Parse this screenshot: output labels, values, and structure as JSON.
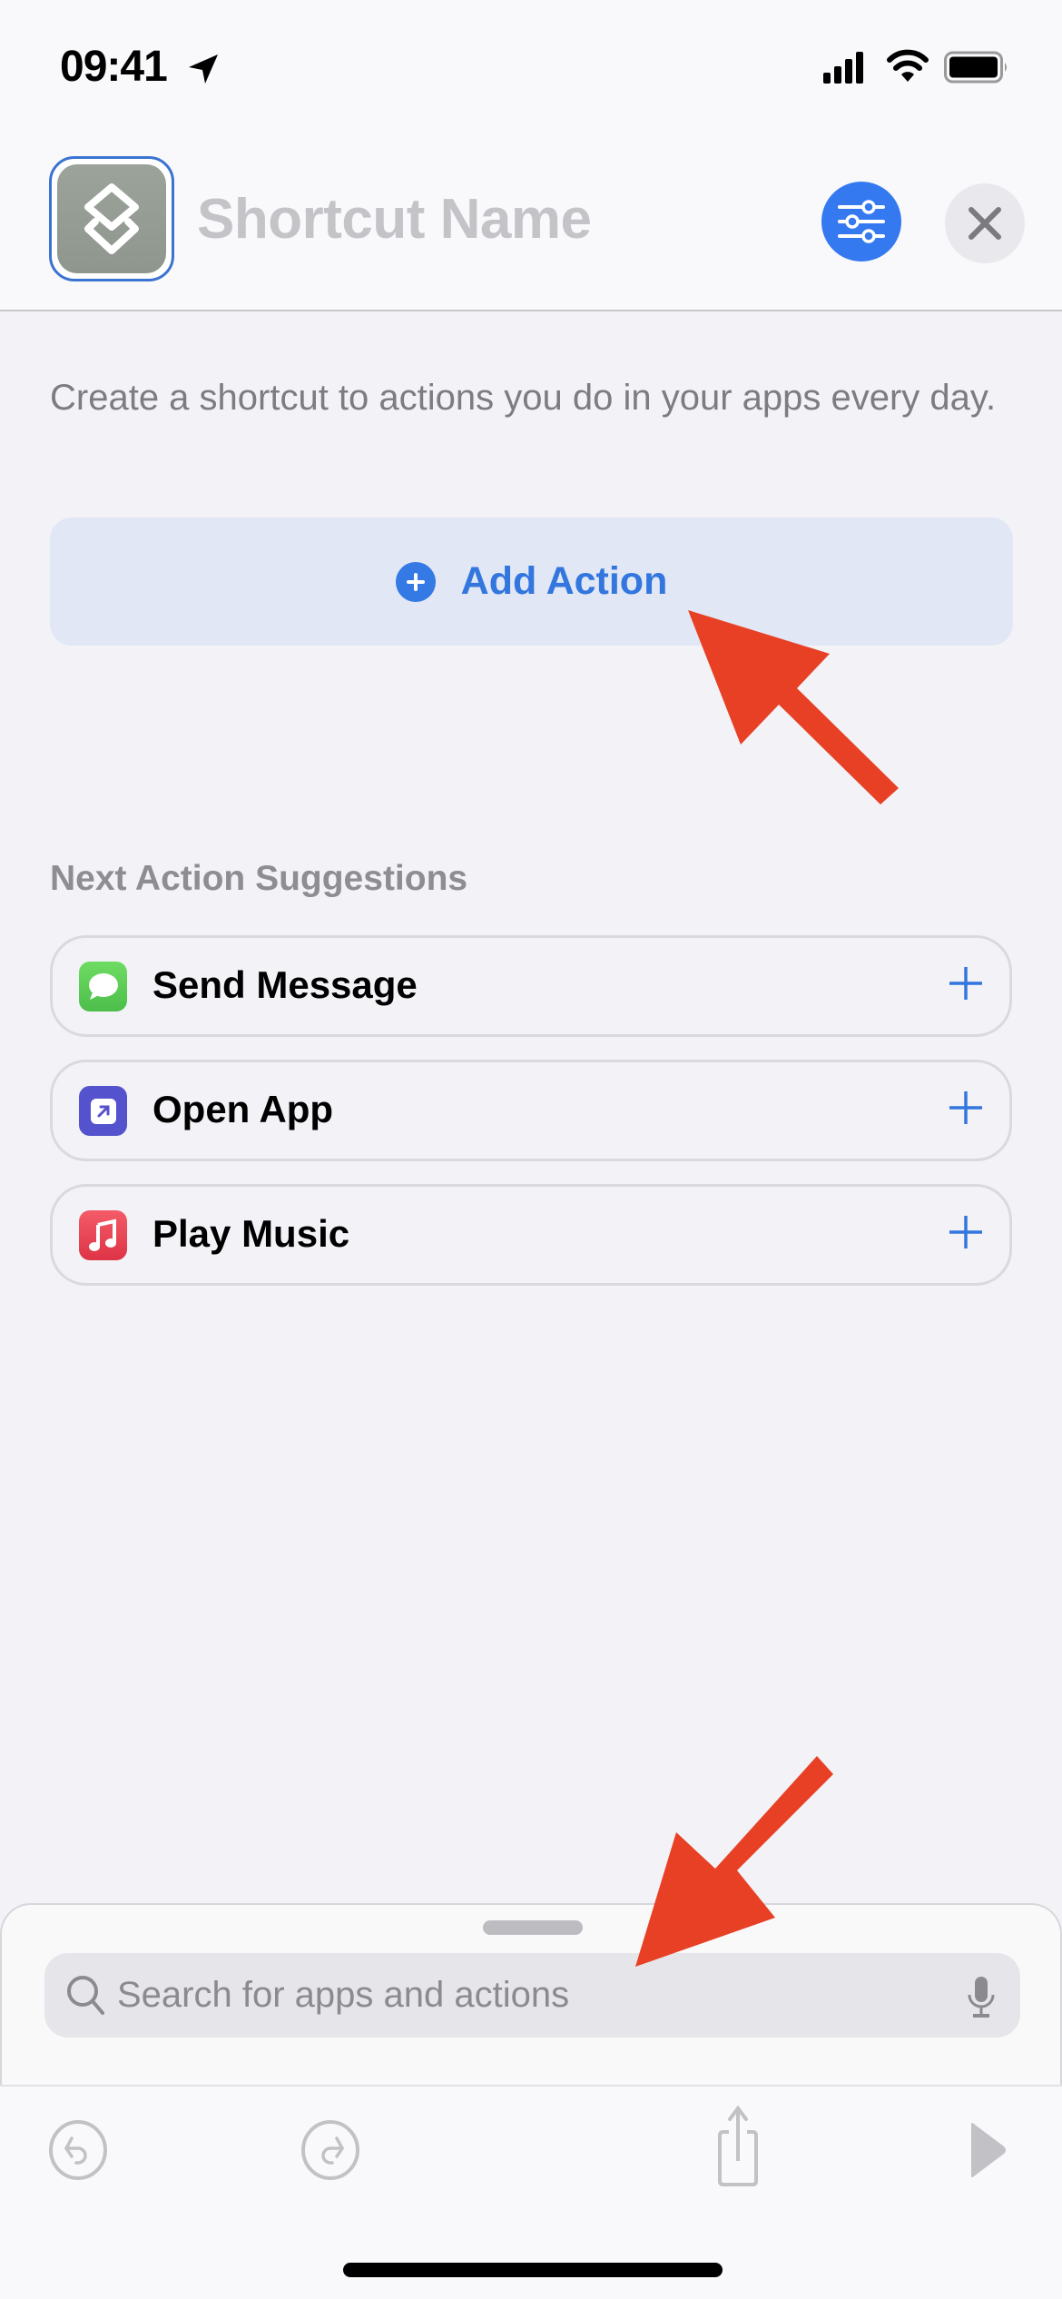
{
  "status_bar": {
    "time": "09:41",
    "icons": [
      "location-arrow-icon",
      "cellular-signal-icon",
      "wifi-icon",
      "battery-icon"
    ]
  },
  "header": {
    "shortcut_name_placeholder": "Shortcut Name",
    "icon": "shortcuts-icon",
    "settings_button": "sliders-icon",
    "close_button": "close-icon",
    "accent_color": "#3479f0"
  },
  "main": {
    "intro_text": "Create a shortcut to actions you do in your apps every day.",
    "add_action_label": "Add Action",
    "suggestions_title": "Next Action Suggestions",
    "suggestions": [
      {
        "label": "Send Message",
        "icon": "messages-icon",
        "color": "#5fcf5a"
      },
      {
        "label": "Open App",
        "icon": "open-app-icon",
        "color": "#5452cc"
      },
      {
        "label": "Play Music",
        "icon": "music-icon",
        "color": "#e9404e"
      }
    ]
  },
  "search": {
    "placeholder": "Search for apps and actions",
    "value": ""
  },
  "toolbar": {
    "buttons": [
      "undo-icon",
      "redo-icon",
      "share-icon",
      "play-icon"
    ]
  },
  "annotations": {
    "arrow_color": "#e84025"
  }
}
